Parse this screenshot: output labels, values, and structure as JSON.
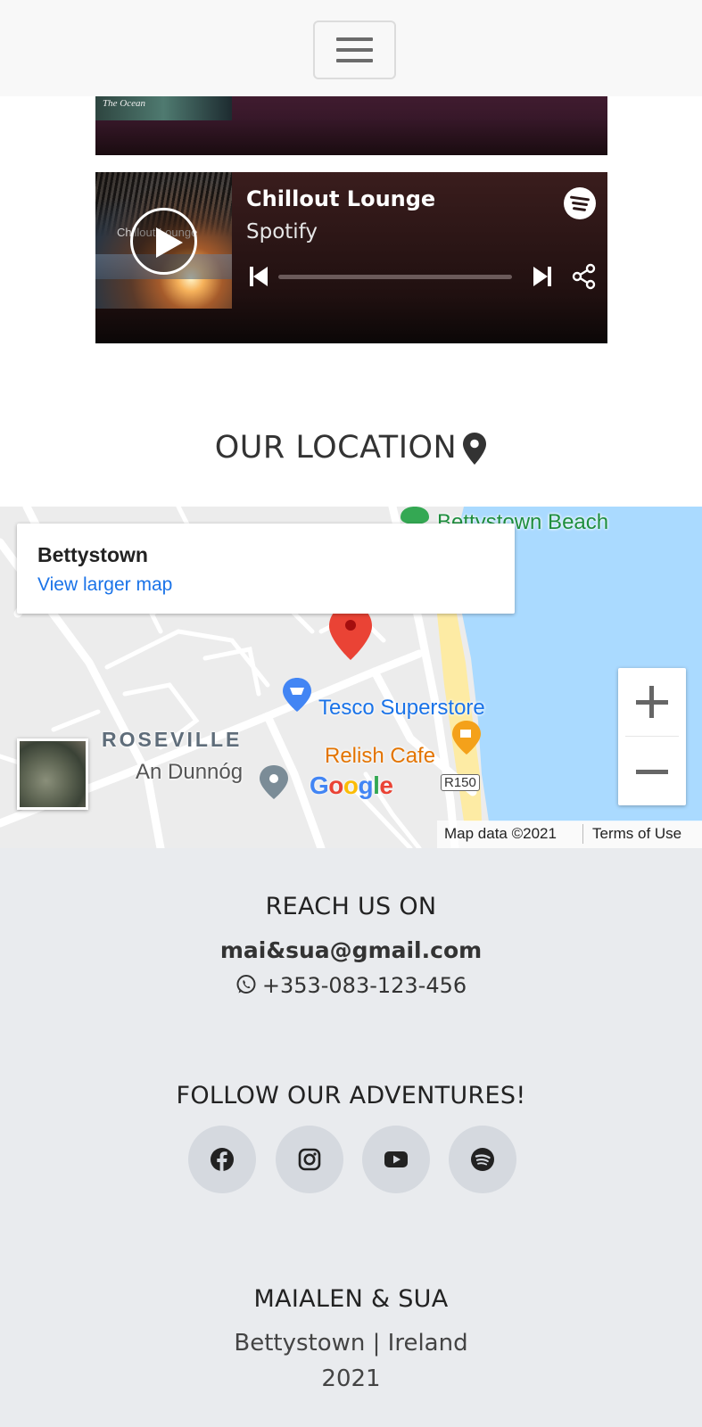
{
  "navbar": {
    "toggle_icon": "hamburger-menu-icon"
  },
  "player_top": {
    "cover_text": "The Ocean"
  },
  "player_main": {
    "cover_text": "Chillout Lounge",
    "title": "Chillout Lounge",
    "artist": "Spotify",
    "progress": 0
  },
  "location": {
    "heading": "OUR LOCATION",
    "pin_icon": "map-marker-icon"
  },
  "map": {
    "place_name": "Bettystown",
    "larger_map_link": "View larger map",
    "labels": {
      "beach": "Bettystown Beach",
      "tesco": "Tesco Superstore",
      "relish": "Relish Cafe",
      "roseville": "ROSEVILLE",
      "dunnog": "An Dunnóg",
      "road": "R150"
    },
    "attribution": "Map data ©2021",
    "terms": "Terms of Use",
    "zoom_in_icon": "plus-icon",
    "zoom_out_icon": "minus-icon",
    "colors": {
      "water": "#aadaff",
      "pin": "#ea4335",
      "park": "#ffeb9c"
    }
  },
  "footer": {
    "reach_heading": "REACH US ON",
    "email": "mai&sua@gmail.com",
    "phone": "+353-083-123-456",
    "follow_heading": "FOLLOW OUR ADVENTURES!",
    "socials": [
      "facebook-icon",
      "instagram-icon",
      "youtube-icon",
      "spotify-icon"
    ],
    "brand": "MAIALEN & SUA",
    "place": "Bettystown | Ireland",
    "year": "2021",
    "background": "#e9ebee"
  }
}
